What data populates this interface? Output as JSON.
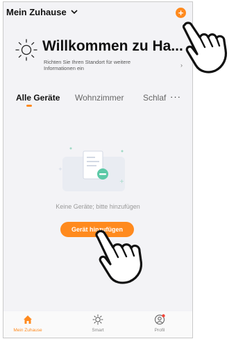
{
  "header": {
    "home_title": "Mein Zuhause",
    "add_icon": "plus-icon"
  },
  "welcome": {
    "title": "Willkommen zu Ha...",
    "subtitle": "Richten Sie Ihren Standort für weitere Informationen ein",
    "arrow": "›"
  },
  "tabs": [
    {
      "label": "Alle Geräte",
      "active": true
    },
    {
      "label": "Wohnzimmer",
      "active": false
    },
    {
      "label": "Schlaf",
      "active": false
    }
  ],
  "more_label": "···",
  "empty": {
    "text": "Keine Geräte; bitte hinzufügen",
    "button_label": "Gerät hinzufügen"
  },
  "bottom_nav": [
    {
      "label": "Mein Zuhause",
      "icon": "home-icon",
      "active": true
    },
    {
      "label": "Smart",
      "icon": "sun-icon",
      "active": false
    },
    {
      "label": "Profil",
      "icon": "profile-icon",
      "active": false
    }
  ],
  "colors": {
    "accent": "#ff8a1e",
    "background": "#f3f3f6"
  }
}
